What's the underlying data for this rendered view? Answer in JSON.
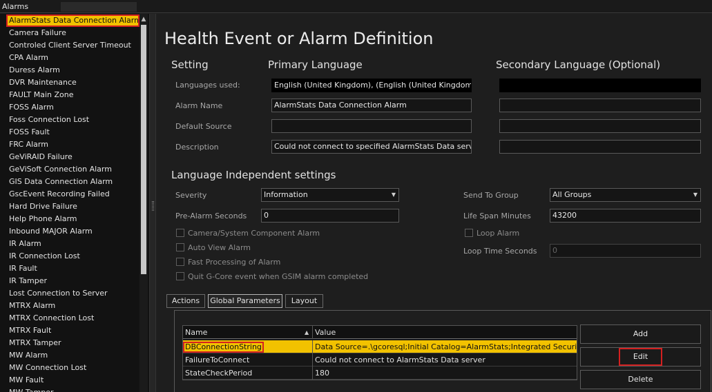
{
  "window": {
    "title": "Alarms"
  },
  "alarm_list": {
    "items": [
      "AlarmStats Data Connection Alarm",
      "Camera Failure",
      "Controled Client Server Timeout",
      "CPA Alarm",
      "Duress Alarm",
      "DVR Maintenance",
      "FAULT Main Zone",
      "FOSS Alarm",
      "Foss Connection Lost",
      "FOSS Fault",
      "FRC Alarm",
      "GeViRAID Failure",
      "GeViSoft Connection Alarm",
      "GIS Data Connection Alarm",
      "GscEvent Recording Failed",
      "Hard Drive Failure",
      "Help Phone Alarm",
      "Inbound MAJOR Alarm",
      "IR Alarm",
      "IR Connection Lost",
      "IR Fault",
      "IR Tamper",
      "Lost Connection to Server",
      "MTRX Alarm",
      "MTRX Connection Lost",
      "MTRX Fault",
      "MTRX Tamper",
      "MW Alarm",
      "MW Connection Lost",
      "MW Fault",
      "MW Tamper"
    ],
    "selected_index": 0
  },
  "page": {
    "title": "Health Event or Alarm Definition",
    "col_setting": "Setting",
    "col_primary": "Primary Language",
    "col_secondary": "Secondary Language (Optional)"
  },
  "fields": {
    "languages_used": {
      "label": "Languages used:",
      "primary": "English (United Kingdom), (English (United Kingdom))",
      "secondary": ""
    },
    "alarm_name": {
      "label": "Alarm Name",
      "primary": "AlarmStats Data Connection Alarm",
      "secondary": ""
    },
    "default_source": {
      "label": "Default Source",
      "primary": "",
      "secondary": ""
    },
    "description": {
      "label": "Description",
      "primary": "Could not connect to specified AlarmStats Data server",
      "secondary": ""
    }
  },
  "independent": {
    "heading": "Language Independent settings",
    "severity_label": "Severity",
    "severity_value": "Information",
    "pre_alarm_label": "Pre-Alarm Seconds",
    "pre_alarm_value": "0",
    "send_to_group_label": "Send To Group",
    "send_to_group_value": "All Groups",
    "life_span_label": "Life Span Minutes",
    "life_span_value": "43200",
    "loop_alarm_label": "Loop Alarm",
    "loop_time_label": "Loop Time Seconds",
    "loop_time_value": "0",
    "checkboxes": [
      "Camera/System Component Alarm",
      "Auto View Alarm",
      "Fast Processing of Alarm",
      "Quit G-Core event when GSIM alarm completed"
    ]
  },
  "tabs": [
    {
      "label": "Actions",
      "active": false
    },
    {
      "label": "Global Parameters",
      "active": true
    },
    {
      "label": "Layout",
      "active": false
    }
  ],
  "params_table": {
    "headers": [
      "Name",
      "Value"
    ],
    "rows": [
      {
        "name": "DBConnectionString",
        "value": "Data Source=.\\gcoresql;Initial Catalog=AlarmStats;Integrated Security=True"
      },
      {
        "name": "FailureToConnect",
        "value": "Could not connect to AlarmStats Data server"
      },
      {
        "name": "StateCheckPeriod",
        "value": "180"
      }
    ],
    "selected_row": 0
  },
  "buttons": {
    "add": "Add",
    "edit": "Edit",
    "delete": "Delete"
  },
  "icons": {
    "scroll_up": "chevron-up-icon",
    "sort": "sort-ascending-icon",
    "dropdown": "chevron-down-icon"
  },
  "colors": {
    "selection": "#f2c200",
    "highlight_outline": "#d42020",
    "background": "#1e1e1e"
  }
}
